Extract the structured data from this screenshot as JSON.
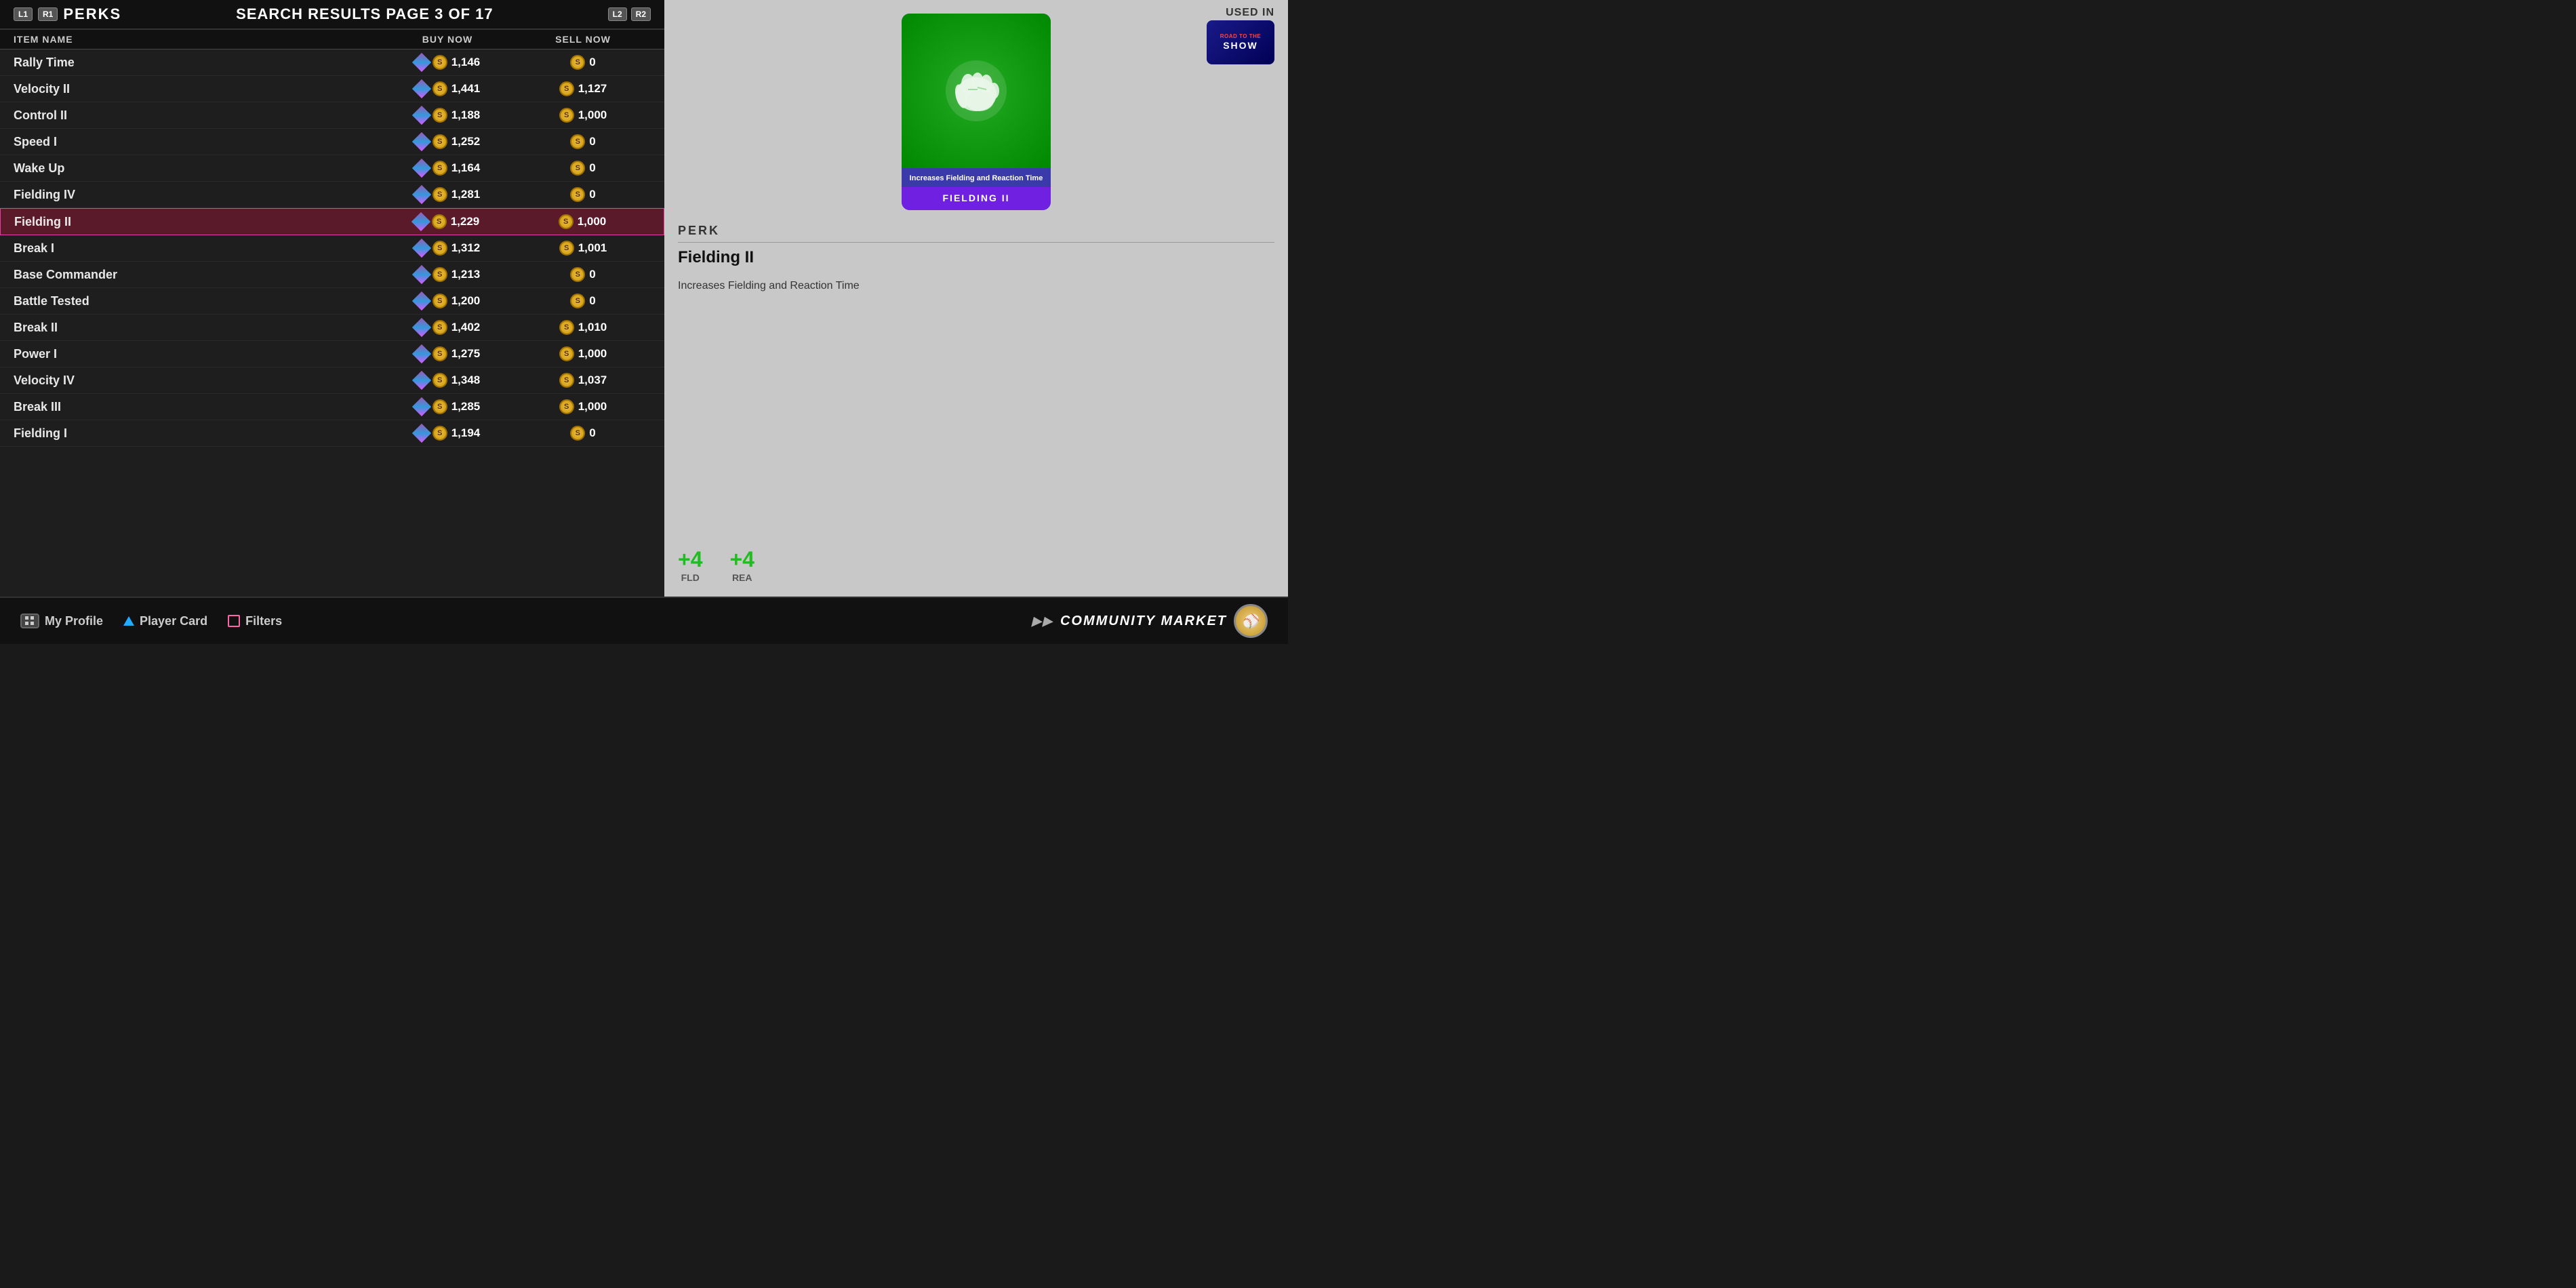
{
  "header": {
    "btn_l1": "L1",
    "btn_r1": "R1",
    "perks_label": "PERKS",
    "search_title": "SEARCH RESULTS PAGE 3 OF 17",
    "btn_l2": "L2",
    "btn_r2": "R2"
  },
  "table": {
    "col_item": "ITEM NAME",
    "col_buy": "BUY NOW",
    "col_sell": "SELL NOW",
    "rows": [
      {
        "name": "Rally Time",
        "buy": "1,146",
        "sell": "0",
        "selected": false
      },
      {
        "name": "Velocity II",
        "buy": "1,441",
        "sell": "1,127",
        "selected": false
      },
      {
        "name": "Control II",
        "buy": "1,188",
        "sell": "1,000",
        "selected": false
      },
      {
        "name": "Speed I",
        "buy": "1,252",
        "sell": "0",
        "selected": false
      },
      {
        "name": "Wake Up",
        "buy": "1,164",
        "sell": "0",
        "selected": false
      },
      {
        "name": "Fielding IV",
        "buy": "1,281",
        "sell": "0",
        "selected": false
      },
      {
        "name": "Fielding II",
        "buy": "1,229",
        "sell": "1,000",
        "selected": true
      },
      {
        "name": "Break I",
        "buy": "1,312",
        "sell": "1,001",
        "selected": false
      },
      {
        "name": "Base Commander",
        "buy": "1,213",
        "sell": "0",
        "selected": false
      },
      {
        "name": "Battle Tested",
        "buy": "1,200",
        "sell": "0",
        "selected": false
      },
      {
        "name": "Break II",
        "buy": "1,402",
        "sell": "1,010",
        "selected": false
      },
      {
        "name": "Power I",
        "buy": "1,275",
        "sell": "1,000",
        "selected": false
      },
      {
        "name": "Velocity IV",
        "buy": "1,348",
        "sell": "1,037",
        "selected": false
      },
      {
        "name": "Break III",
        "buy": "1,285",
        "sell": "1,000",
        "selected": false
      },
      {
        "name": "Fielding I",
        "buy": "1,194",
        "sell": "0",
        "selected": false
      }
    ]
  },
  "detail": {
    "used_in_label": "USED IN",
    "card_label": "FIELDING II",
    "card_description": "Increases Fielding and\nReaction Time",
    "perk_section": "PERK",
    "perk_name": "Fielding II",
    "perk_desc": "Increases Fielding and Reaction Time",
    "stat1_value": "+4",
    "stat1_label": "FLD",
    "stat2_value": "+4",
    "stat2_label": "REA"
  },
  "bottom": {
    "my_profile": "My Profile",
    "player_card": "Player Card",
    "filters": "Filters",
    "community_market": "COMMUNITY MARKET"
  }
}
